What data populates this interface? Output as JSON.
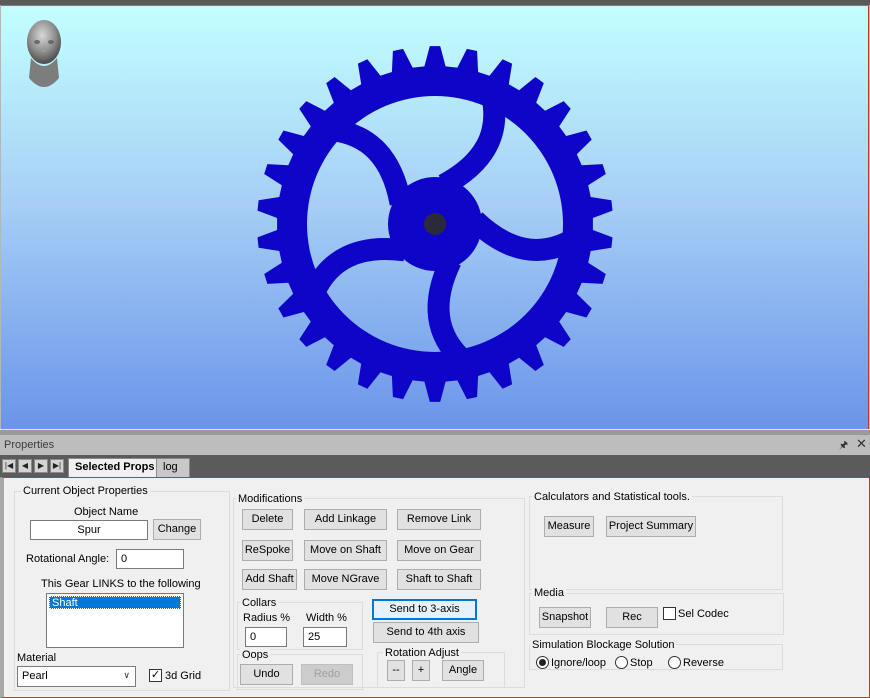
{
  "panel": {
    "title": "Properties",
    "pin_icon": "pin-icon",
    "close_icon": "close-icon",
    "tabs": [
      {
        "label": "Selected Props",
        "active": true
      },
      {
        "label": "log",
        "active": false
      }
    ]
  },
  "current_object": {
    "group_title": "Current Object Properties",
    "object_name_label": "Object Name",
    "object_name_value": "Spur",
    "change_label": "Change",
    "rotational_angle_label": "Rotational Angle:",
    "rotational_angle_value": "0",
    "links_label": "This Gear LINKS to the following",
    "links": [
      "Shaft"
    ],
    "material_label": "Material",
    "material_value": "Pearl",
    "grid_label": "3d Grid",
    "grid_checked": true
  },
  "modifications": {
    "group_title": "Modifications",
    "buttons": {
      "delete": "Delete",
      "add_linkage": "Add Linkage",
      "remove_link": "Remove Link",
      "respoke": "ReSpoke",
      "move_on_shaft": "Move on Shaft",
      "move_on_gear": "Move on Gear",
      "add_shaft": "Add Shaft",
      "move_ngrave": "Move NGrave",
      "shaft_to_shaft": "Shaft to Shaft",
      "send_3axis": "Send to 3-axis",
      "send_4axis": "Send to 4th axis"
    },
    "collars": {
      "title": "Collars",
      "radius_label": "Radius %",
      "radius_value": "0",
      "width_label": "Width %",
      "width_value": "25"
    },
    "oops": {
      "title": "Oops",
      "undo": "Undo",
      "redo": "Redo"
    },
    "rotation": {
      "title": "Rotation Adjust",
      "minus": "--",
      "plus": "+",
      "angle": "Angle"
    }
  },
  "calculators": {
    "group_title": "Calculators and Statistical tools.",
    "measure": "Measure",
    "project_summary": "Project Summary"
  },
  "media": {
    "group_title": "Media",
    "snapshot": "Snapshot",
    "rec": "Rec",
    "sel_codec": "Sel Codec",
    "sel_codec_checked": false
  },
  "simulation": {
    "group_title": "Simulation Blockage Solution",
    "options": [
      "Ignore/loop",
      "Stop",
      "Reverse"
    ],
    "selected": "Ignore/loop"
  },
  "colors": {
    "gear": "#0f05c8",
    "hub_center": "#2a2a3a"
  }
}
